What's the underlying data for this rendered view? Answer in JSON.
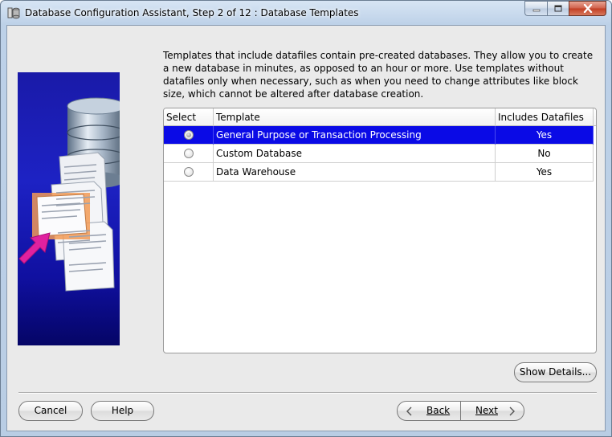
{
  "window": {
    "title": "Database Configuration Assistant, Step 2 of 12 : Database Templates"
  },
  "description": "Templates that include datafiles contain pre-created databases. They allow you to create a new database in minutes, as opposed to an hour or more. Use templates without datafiles only when necessary, such as when you need to change attributes like block size, which cannot be altered after database creation.",
  "table": {
    "headers": {
      "select": "Select",
      "template": "Template",
      "datafiles": "Includes Datafiles"
    },
    "rows": [
      {
        "template": "General Purpose or Transaction Processing",
        "datafiles": "Yes",
        "selected": true
      },
      {
        "template": "Custom Database",
        "datafiles": "No",
        "selected": false
      },
      {
        "template": "Data Warehouse",
        "datafiles": "Yes",
        "selected": false
      }
    ]
  },
  "buttons": {
    "show_details": "Show Details...",
    "cancel": "Cancel",
    "help": "Help",
    "back": "Back",
    "next": "Next"
  },
  "colors": {
    "selection": "#0a0ae6",
    "side_image": "#1d22c4",
    "close_button": "#c23d22"
  },
  "icons": {
    "app": "database-icon",
    "side_illustration": "database-templates-illustration"
  }
}
